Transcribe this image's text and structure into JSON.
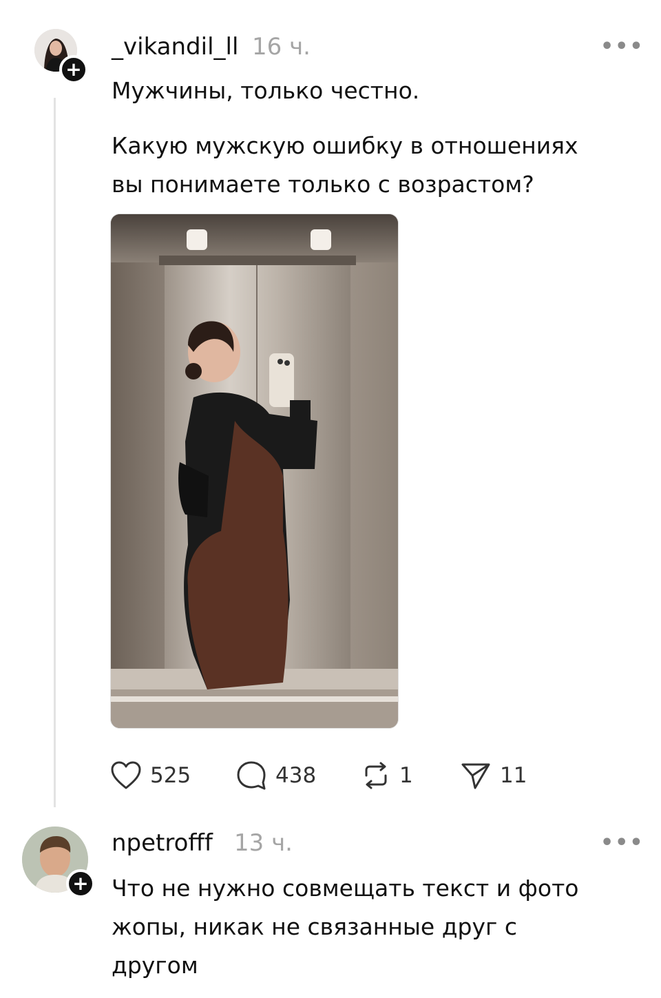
{
  "post": {
    "username": "_vikandil_ll",
    "time": "16 ч.",
    "more_label": "•••",
    "follow_label": "+",
    "text_line1": "Мужчины, только честно.",
    "text_line2": "Какую мужскую ошибку в отношениях",
    "text_line3": "вы понимаете только с возрастом?",
    "likes": "525",
    "comments": "438",
    "reposts": "1",
    "shares": "11"
  },
  "reply": {
    "username": "npetrofff",
    "time": "13 ч.",
    "more_label": "•••",
    "follow_label": "+",
    "text_line1": "Что не нужно совмещать текст и фото",
    "text_line2": "жопы, никак не связанные друг с",
    "text_line3": "другом"
  },
  "icons": {
    "like": "heart-icon",
    "comment": "comment-bubble-icon",
    "repost": "repost-icon",
    "share": "send-icon",
    "more": "more-dots-icon"
  }
}
